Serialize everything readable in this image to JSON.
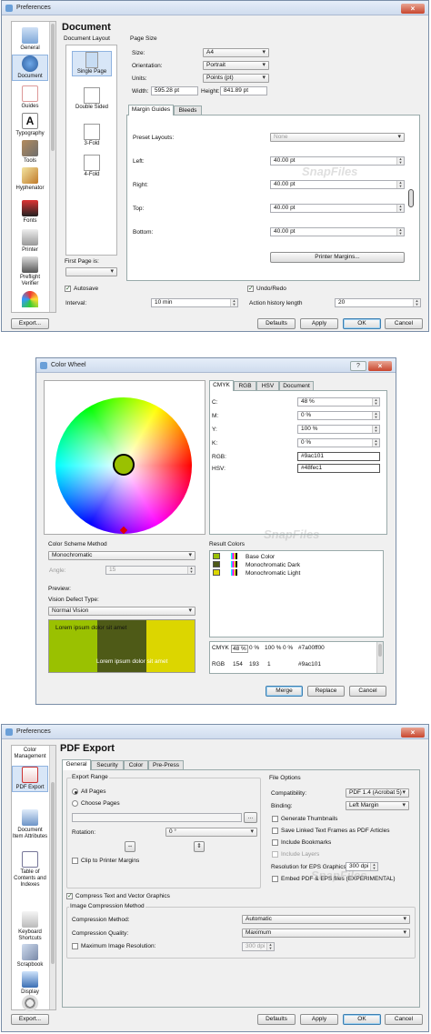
{
  "w1": {
    "title": "Preferences",
    "heading": "Document",
    "sidebar": [
      "General",
      "Document",
      "Guides",
      "Typography",
      "Tools",
      "Hyphenator",
      "Fonts",
      "Printer",
      "Preflight Verifier",
      ""
    ],
    "layout_title": "Document Layout",
    "layouts": [
      "Single Page",
      "Double Sided",
      "3-Fold",
      "4-Fold"
    ],
    "first_page_label": "First Page is:",
    "page_size_title": "Page Size",
    "size_label": "Size:",
    "size_value": "A4",
    "orientation_label": "Orientation:",
    "orientation_value": "Portrait",
    "units_label": "Units:",
    "units_value": "Points (pt)",
    "width_label": "Width:",
    "width_value": "595.28 pt",
    "height_label": "Height:",
    "height_value": "841.89 pt",
    "tabs": [
      "Margin Guides",
      "Bleeds"
    ],
    "preset_label": "Preset Layouts:",
    "preset_value": "None",
    "left_label": "Left:",
    "left_value": "40.00 pt",
    "right_label": "Right:",
    "right_value": "40.00 pt",
    "top_label": "Top:",
    "top_value": "40.00 pt",
    "bottom_label": "Bottom:",
    "bottom_value": "40.00 pt",
    "printer_margins": "Printer Margins...",
    "autosave_label": "Autosave",
    "interval_label": "Interval:",
    "interval_value": "10 min",
    "undo_label": "Undo/Redo",
    "history_label": "Action history length",
    "history_value": "20",
    "export": "Export...",
    "defaults": "Defaults",
    "apply": "Apply",
    "ok": "OK",
    "cancel": "Cancel",
    "watermark": "SnapFiles"
  },
  "w2": {
    "title": "Color Wheel",
    "help": "?",
    "tabs": [
      "CMYK",
      "RGB",
      "HSV",
      "Document"
    ],
    "c_label": "C:",
    "c_value": "48 %",
    "m_label": "M:",
    "m_value": "0 %",
    "y_label": "Y:",
    "y_value": "100 %",
    "k_label": "K:",
    "k_value": "0 %",
    "rgb_label": "RGB:",
    "rgb_value": "#9ac101",
    "hsv_label": "HSV:",
    "hsv_value": "#48fec1",
    "scheme_title": "Color Scheme Method",
    "scheme_value": "Monochromatic",
    "angle_label": "Angle:",
    "angle_value": "15",
    "preview_title": "Preview:",
    "vision_label": "Vision Defect Type:",
    "vision_value": "Normal Vision",
    "lorem": "Lorem ipsum dolor sit amet",
    "result_title": "Result Colors",
    "results": [
      "Base Color",
      "Monochromatic Dark",
      "Monochromatic Light"
    ],
    "cmyk_row": [
      "CMYK",
      "48 %",
      "0 %",
      "100 %",
      "0 %",
      "#7a00ff00"
    ],
    "rgb_row": [
      "RGB",
      "154",
      "193",
      "1",
      "#9ac101"
    ],
    "merge": "Merge",
    "replace": "Replace",
    "cancel": "Cancel",
    "base_color": "#9ac101",
    "dark_color": "#4e5a17",
    "light_color": "#dcd600",
    "watermark": "SnapFiles"
  },
  "w3": {
    "title": "Preferences",
    "heading": "PDF Export",
    "sidebar": [
      "Color Management",
      "PDF Export",
      "Document Item Attributes",
      "Table of Contents and Indexes",
      "Keyboard Shortcuts",
      "Scrapbook",
      "Display"
    ],
    "tabs": [
      "General",
      "Security",
      "Color",
      "Pre-Press"
    ],
    "export_range_title": "Export Range",
    "all_pages": "All Pages",
    "choose_pages": "Choose Pages",
    "browse": "...",
    "rotation_label": "Rotation:",
    "rotation_value": "0 °",
    "clip_label": "Clip to Printer Margins",
    "file_options_title": "File Options",
    "compat_label": "Compatibility:",
    "compat_value": "PDF 1.4 (Acrobat 5)",
    "binding_label": "Binding:",
    "binding_value": "Left Margin",
    "gen_thumbs": "Generate Thumbnails",
    "save_linked": "Save Linked Text Frames as PDF Articles",
    "bookmarks": "Include Bookmarks",
    "layers": "Include Layers",
    "resolution_label": "Resolution for EPS Graphics:",
    "resolution_value": "300 dpi",
    "embed_eps": "Embed PDF & EPS files (EXPERIMENTAL)",
    "compress_label": "Compress Text and Vector Graphics",
    "image_comp_title": "Image Compression Method",
    "comp_method_label": "Compression Method:",
    "comp_method_value": "Automatic",
    "comp_quality_label": "Compression Quality:",
    "comp_quality_value": "Maximum",
    "max_res_label": "Maximum Image Resolution:",
    "max_res_value": "300 dpi",
    "export": "Export...",
    "defaults": "Defaults",
    "apply": "Apply",
    "ok": "OK",
    "cancel": "Cancel",
    "watermark": "SnapFiles"
  }
}
